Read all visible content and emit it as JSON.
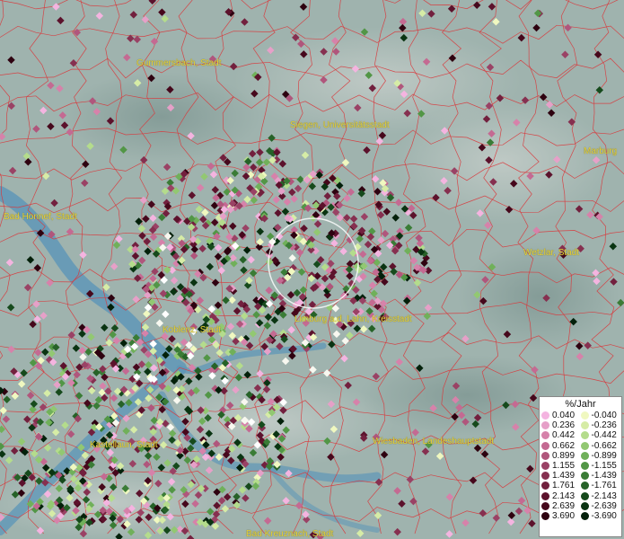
{
  "cities": [
    {
      "id": "gummersbach",
      "label": "Gummersbach, Stadt"
    },
    {
      "id": "siegen",
      "label": "Siegen, Universitätsstadt"
    },
    {
      "id": "marburg",
      "label": "Marburg"
    },
    {
      "id": "bad-honnef",
      "label": "Bad Honnef, Stadt"
    },
    {
      "id": "wetzlar",
      "label": "Wetzlar, Stadt"
    },
    {
      "id": "limburg",
      "label": "Limburg a.d. Lahn, Kreisstadt"
    },
    {
      "id": "koblenz",
      "label": "Koblenz, Stadt"
    },
    {
      "id": "kastellaun",
      "label": "Kastellaun, Stadt"
    },
    {
      "id": "wiesbaden",
      "label": "Wiesbaden, Landeshauptstadt"
    },
    {
      "id": "bad-kreuznach",
      "label": "Bad Kreuznach, Stadt"
    }
  ],
  "legend": {
    "title": "%/Jahr",
    "positive": [
      {
        "label": "0.040",
        "color": "#f4b4e0"
      },
      {
        "label": "0.236",
        "color": "#e6a0c8"
      },
      {
        "label": "0.442",
        "color": "#d682aa"
      },
      {
        "label": "0.662",
        "color": "#c46a92"
      },
      {
        "label": "0.899",
        "color": "#b0567c"
      },
      {
        "label": "1.155",
        "color": "#9a4265"
      },
      {
        "label": "1.439",
        "color": "#863050"
      },
      {
        "label": "1.761",
        "color": "#72203e"
      },
      {
        "label": "2.143",
        "color": "#5c122c"
      },
      {
        "label": "2.639",
        "color": "#46081c"
      },
      {
        "label": "3.690",
        "color": "#2e0210"
      }
    ],
    "negative": [
      {
        "label": "-0.040",
        "color": "#f0f8c0"
      },
      {
        "label": "-0.236",
        "color": "#d6eca6"
      },
      {
        "label": "-0.442",
        "color": "#b4dc8c"
      },
      {
        "label": "-0.662",
        "color": "#92c872"
      },
      {
        "label": "-0.899",
        "color": "#70b05a"
      },
      {
        "label": "-1.155",
        "color": "#529646"
      },
      {
        "label": "-1.439",
        "color": "#3a7c36"
      },
      {
        "label": "-1.761",
        "color": "#266228"
      },
      {
        "label": "-2.143",
        "color": "#164a1c"
      },
      {
        "label": "-2.639",
        "color": "#0a3412"
      },
      {
        "label": "-3.690",
        "color": "#03200a"
      }
    ]
  },
  "colors": {
    "terrain": "#9fb3ae",
    "water": "#5b95b8",
    "borders": "#d8383c",
    "city_text": "#e6d23a",
    "focus_circle": "#ffffff"
  }
}
